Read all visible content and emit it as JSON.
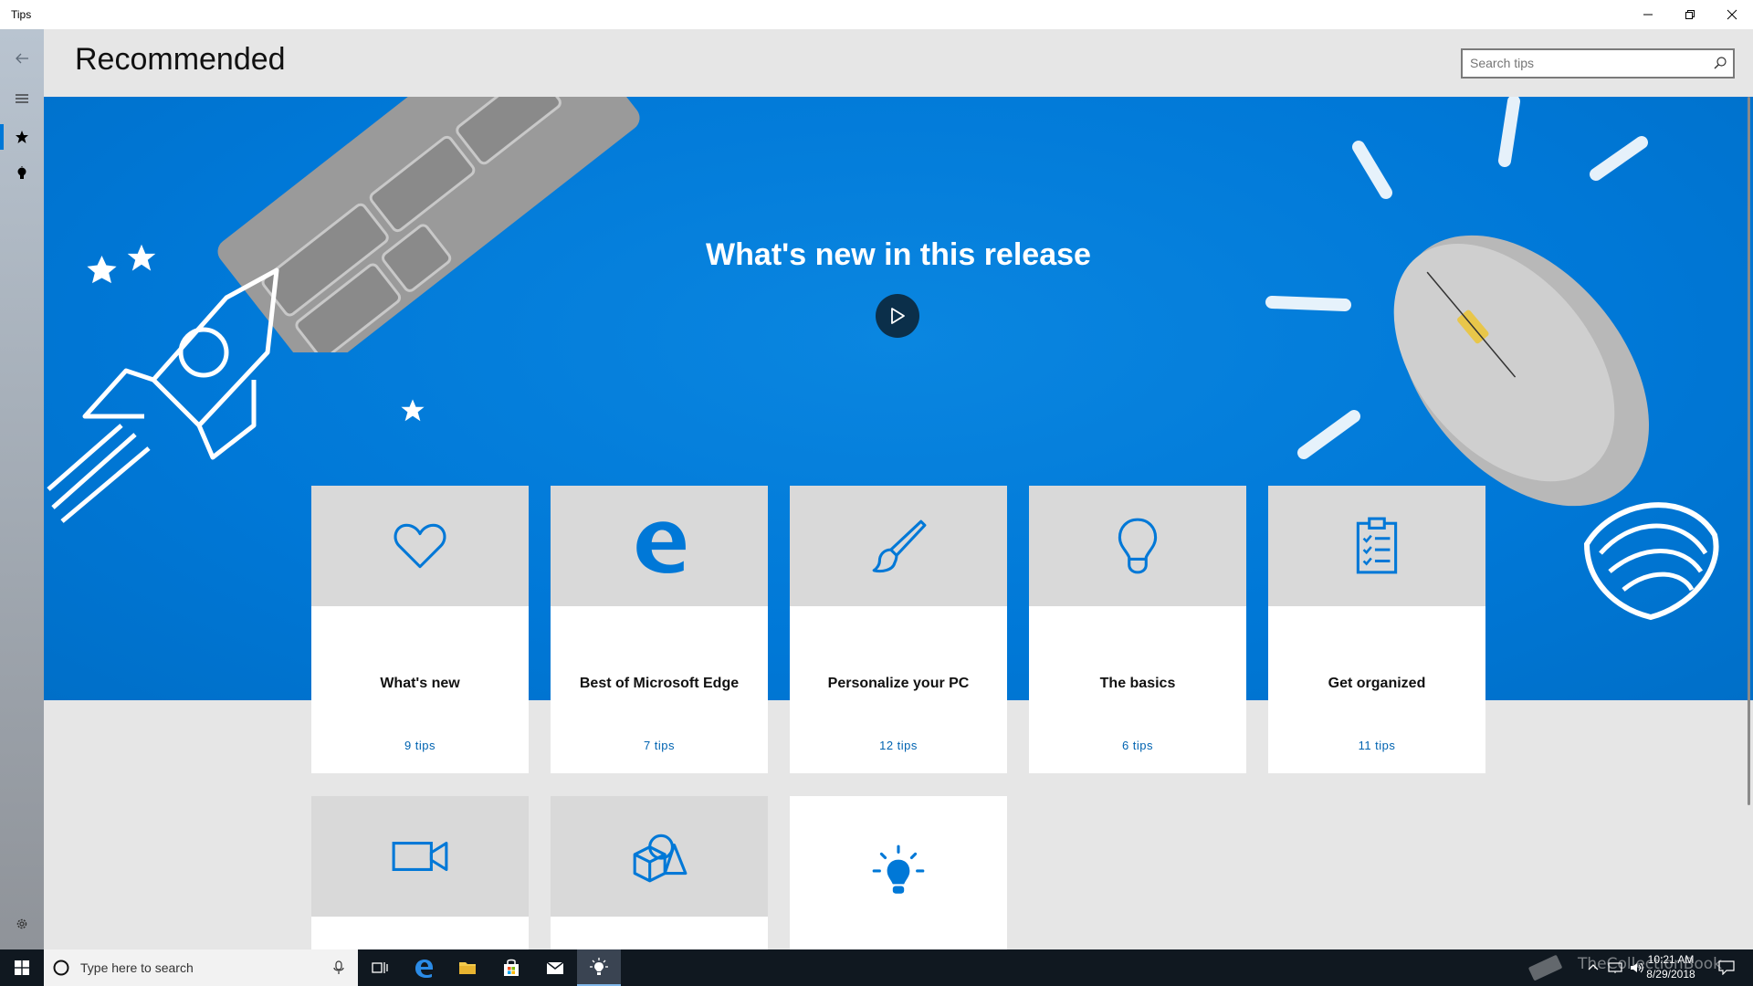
{
  "window": {
    "title": "Tips"
  },
  "header": {
    "title": "Recommended",
    "search_placeholder": "Search tips"
  },
  "hero": {
    "title": "What's new in this release"
  },
  "cards": [
    {
      "title": "What's new",
      "count": "9 tips",
      "icon": "heart-icon"
    },
    {
      "title": "Best of Microsoft Edge",
      "count": "7 tips",
      "icon": "edge-icon"
    },
    {
      "title": "Personalize your PC",
      "count": "12 tips",
      "icon": "paintbrush-icon"
    },
    {
      "title": "The basics",
      "count": "6 tips",
      "icon": "lightbulb-icon"
    },
    {
      "title": "Get organized",
      "count": "11 tips",
      "icon": "clipboard-icon"
    },
    {
      "title": "",
      "count": "",
      "icon": "video-camera-icon"
    },
    {
      "title": "",
      "count": "",
      "icon": "3d-shapes-icon"
    },
    {
      "title": "",
      "count": "",
      "icon": "lit-bulb-icon"
    }
  ],
  "taskbar": {
    "search_placeholder": "Type here to search",
    "time": "10:21 AM",
    "date": "8/29/2018",
    "watermark": "TheCollectionBook"
  },
  "colors": {
    "accent": "#0078d7",
    "link": "#0063b1",
    "card_top": "#d9d9d9",
    "taskbar": "#101820"
  }
}
